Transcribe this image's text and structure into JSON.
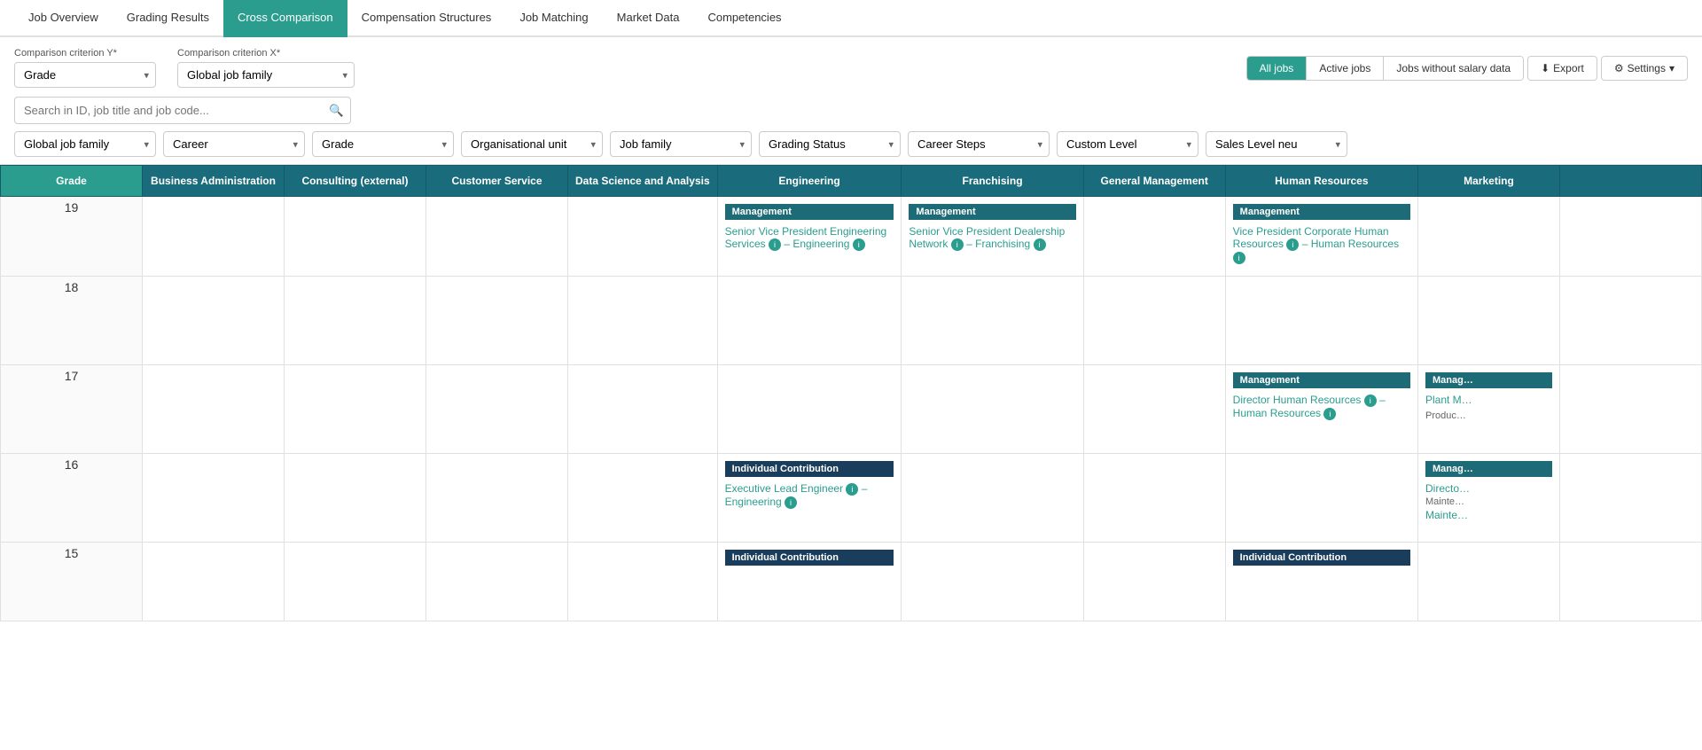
{
  "nav": {
    "tabs": [
      {
        "id": "job-overview",
        "label": "Job Overview",
        "active": false
      },
      {
        "id": "grading-results",
        "label": "Grading Results",
        "active": false
      },
      {
        "id": "cross-comparison",
        "label": "Cross Comparison",
        "active": true
      },
      {
        "id": "compensation-structures",
        "label": "Compensation Structures",
        "active": false
      },
      {
        "id": "job-matching",
        "label": "Job Matching",
        "active": false
      },
      {
        "id": "market-data",
        "label": "Market Data",
        "active": false
      },
      {
        "id": "competencies",
        "label": "Competencies",
        "active": false
      }
    ]
  },
  "toolbar": {
    "criteria_y_label": "Comparison criterion Y*",
    "criteria_x_label": "Comparison criterion X*",
    "criteria_y_value": "Grade",
    "criteria_x_value": "Global job family",
    "filter_buttons": [
      "All jobs",
      "Active jobs",
      "Jobs without salary data"
    ],
    "export_label": "Export",
    "settings_label": "Settings"
  },
  "search": {
    "placeholder": "Search in ID, job title and job code..."
  },
  "filters": [
    {
      "id": "global-job-family",
      "value": "Global job family"
    },
    {
      "id": "career",
      "value": "Career"
    },
    {
      "id": "grade",
      "value": "Grade"
    },
    {
      "id": "organisational-unit",
      "value": "Organisational unit"
    },
    {
      "id": "job-family",
      "value": "Job family"
    },
    {
      "id": "grading-status",
      "value": "Grading Status"
    },
    {
      "id": "career-steps",
      "value": "Career Steps"
    },
    {
      "id": "custom-level",
      "value": "Custom Level"
    },
    {
      "id": "sales-level-neu",
      "value": "Sales Level neu"
    }
  ],
  "grid": {
    "columns": [
      {
        "id": "grade",
        "label": "Grade",
        "isGrade": true
      },
      {
        "id": "business-admin",
        "label": "Business Administration"
      },
      {
        "id": "consulting",
        "label": "Consulting (external)"
      },
      {
        "id": "customer-service",
        "label": "Customer Service"
      },
      {
        "id": "data-science",
        "label": "Data Science and Analysis"
      },
      {
        "id": "engineering",
        "label": "Engineering"
      },
      {
        "id": "franchising",
        "label": "Franchising"
      },
      {
        "id": "general-management",
        "label": "General Management"
      },
      {
        "id": "human-resources",
        "label": "Human Resources"
      },
      {
        "id": "marketing",
        "label": "Marketing"
      }
    ],
    "rows": [
      {
        "grade": 19,
        "cells": {
          "business-admin": null,
          "consulting": null,
          "customer-service": null,
          "data-science": null,
          "engineering": {
            "category": "Management",
            "jobs": [
              {
                "title": "Senior Vice President Engineering Services",
                "sub": "– Engineering",
                "info": true
              }
            ]
          },
          "franchising": {
            "category": "Management",
            "jobs": [
              {
                "title": "Senior Vice President Dealership Network",
                "sub": "– Franchising",
                "info": true
              }
            ]
          },
          "general-management": null,
          "human-resources": {
            "category": "Management",
            "jobs": [
              {
                "title": "Vice President Corporate Human Resources",
                "sub": "– Human Resources",
                "info": true
              }
            ]
          },
          "marketing": null
        }
      },
      {
        "grade": 18,
        "cells": {
          "business-admin": null,
          "consulting": null,
          "customer-service": null,
          "data-science": null,
          "engineering": null,
          "franchising": null,
          "general-management": null,
          "human-resources": null,
          "marketing": null
        }
      },
      {
        "grade": 17,
        "cells": {
          "business-admin": null,
          "consulting": null,
          "customer-service": null,
          "data-science": null,
          "engineering": null,
          "franchising": null,
          "general-management": null,
          "human-resources": {
            "category": "Management",
            "jobs": [
              {
                "title": "Director Human Resources",
                "sub": "– Human Resources",
                "info": true
              }
            ]
          },
          "marketing": {
            "category": "Manag",
            "jobs": [
              {
                "title": "Plant M",
                "sub": "Produc",
                "info": false
              }
            ]
          }
        }
      },
      {
        "grade": 16,
        "cells": {
          "business-admin": null,
          "consulting": null,
          "customer-service": null,
          "data-science": null,
          "engineering": {
            "category": "Individual Contribution",
            "jobs": [
              {
                "title": "Executive Lead Engineer",
                "sub": "– Engineering",
                "info": true
              }
            ]
          },
          "franchising": null,
          "general-management": null,
          "human-resources": null,
          "marketing": {
            "category": "Manag",
            "jobs": [
              {
                "title": "Directo",
                "sub": "Mainte",
                "info": false
              },
              {
                "title": "Mainte",
                "sub": "",
                "info": false
              }
            ]
          }
        }
      },
      {
        "grade": 15,
        "cells": {
          "business-admin": null,
          "consulting": null,
          "customer-service": null,
          "data-science": null,
          "engineering": {
            "category": "Individual Contribution",
            "jobs": []
          },
          "franchising": null,
          "general-management": null,
          "human-resources": {
            "category": "Individual Contribution",
            "jobs": []
          },
          "marketing": null
        }
      }
    ]
  }
}
